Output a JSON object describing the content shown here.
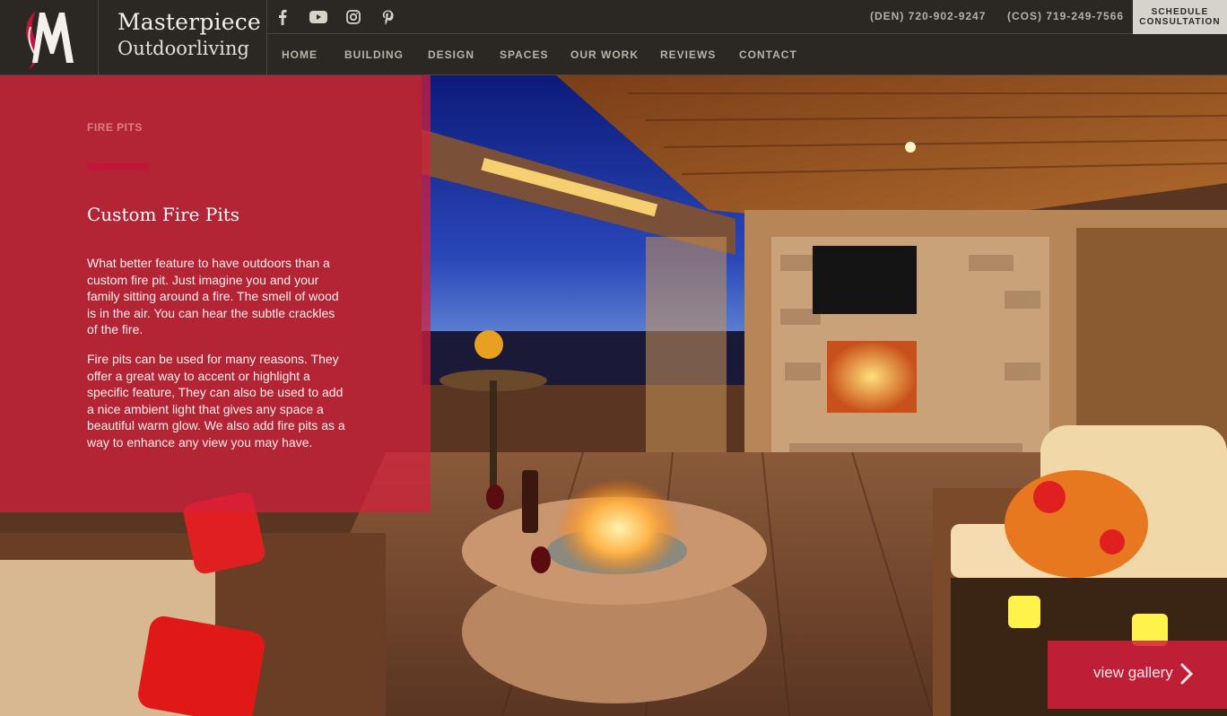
{
  "brand": {
    "logo_icon": "masterpiece-m-logo",
    "name_line1": "Masterpiece",
    "name_line2": "Outdoorliving"
  },
  "social": [
    {
      "icon": "facebook-icon"
    },
    {
      "icon": "youtube-icon"
    },
    {
      "icon": "instagram-icon"
    },
    {
      "icon": "pinterest-icon"
    }
  ],
  "phones": {
    "den": "(DEN) 720-902-9247",
    "cos": "(COS) 719-249-7566"
  },
  "schedule": {
    "line1": "SCHEDULE",
    "line2": "CONSULTATION"
  },
  "nav": {
    "items": [
      "HOME",
      "BUILDING",
      "DESIGN",
      "SPACES",
      "OUR WORK",
      "REVIEWS",
      "CONTACT"
    ]
  },
  "hero": {
    "eyebrow": "FIRE PITS",
    "title": "Custom Fire Pits",
    "paragraph1": "What better feature to have outdoors than a custom fire pit. Just imagine you and your family sitting around a fire. The smell of wood is in the air. You can hear the subtle crackles of the fire.",
    "paragraph2": "Fire pits can be used for many reasons. They offer a great way to accent or highlight a specific feature, They can also be used to add a nice ambient light that gives any space a beautiful warm glow. We also add fire pits as a way to enhance any view you may have.",
    "gallery_label": "view gallery",
    "gallery_icon": "chevron-right-icon"
  },
  "colors": {
    "header_bg": "#2b2824",
    "accent_red": "#d61e3c",
    "schedule_bg": "#d6d2cc"
  }
}
